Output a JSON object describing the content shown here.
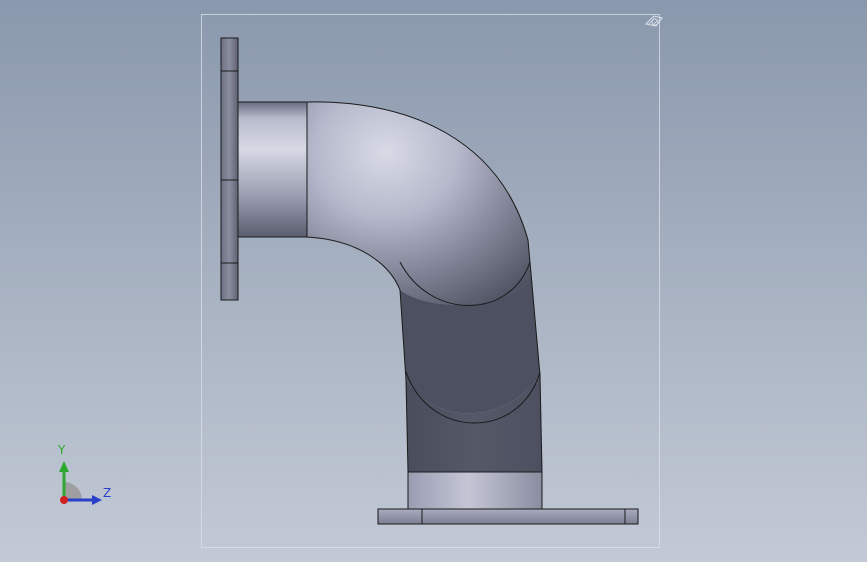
{
  "scene": {
    "background_top": "#8a98ad",
    "background_bottom": "#c3cad6",
    "model_color": "#c8cad8",
    "edge_color": "#1a1a1a"
  },
  "triad": {
    "y_label": "Y",
    "z_label": "Z",
    "y_color": "#2fa82f",
    "z_color": "#2a40c8",
    "x_color": "#d02020"
  },
  "icons": {
    "view_selector": "view-selector-icon",
    "triad": "coordinate-triad-icon"
  }
}
